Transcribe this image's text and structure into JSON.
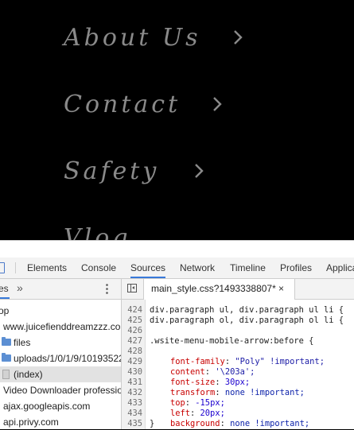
{
  "site_menu": {
    "items": [
      {
        "label": "About Us"
      },
      {
        "label": "Contact"
      },
      {
        "label": "Safety"
      },
      {
        "label": "Vlog"
      }
    ],
    "text_color": "#8a8a8a",
    "arrow_icon": "chevron-right-icon"
  },
  "devtools": {
    "tabs": [
      "Elements",
      "Console",
      "Sources",
      "Network",
      "Timeline",
      "Profiles",
      "Applicat"
    ],
    "active_tab": "Sources",
    "navigator": {
      "sub_tab": "es",
      "more_label": "»",
      "tree": [
        {
          "label": "op",
          "type": "text"
        },
        {
          "label": "www.juicefienddreamzzz.co",
          "type": "text"
        },
        {
          "label": "files",
          "type": "folder"
        },
        {
          "label": "uploads/1/0/1/9/10193522",
          "type": "folder"
        },
        {
          "label": "(index)",
          "type": "file",
          "selected": true
        },
        {
          "label": "Video Downloader professio",
          "type": "text"
        },
        {
          "label": "ajax.googleapis.com",
          "type": "text"
        },
        {
          "label": "api.privy.com",
          "type": "text"
        }
      ]
    },
    "editor": {
      "file_tab": "main_style.css?1493338807*",
      "close_label": "×",
      "lines": [
        {
          "num": "424",
          "text": "div.paragraph ul, div.paragraph ul li {"
        },
        {
          "num": "425",
          "text": "div.paragraph ol, div.paragraph ol li {"
        },
        {
          "num": "426",
          "text": ""
        },
        {
          "num": "427",
          "text": ".wsite-menu-mobile-arrow:before {"
        },
        {
          "num": "428",
          "prop": "font-family",
          "value": "\"Poly\" !important;"
        },
        {
          "num": "429",
          "prop": "content",
          "value": "'\\203a';"
        },
        {
          "num": "430",
          "prop": "font-size",
          "value": "30px;"
        },
        {
          "num": "431",
          "prop": "transform",
          "value": "none !important;"
        },
        {
          "num": "432",
          "prop": "top",
          "value": "-15px;"
        },
        {
          "num": "433",
          "prop": "left",
          "value": "20px;"
        },
        {
          "num": "434",
          "prop": "background",
          "value": "none !important;"
        },
        {
          "num": "435",
          "text": "}"
        }
      ]
    },
    "accent_color": "#3879d9"
  }
}
